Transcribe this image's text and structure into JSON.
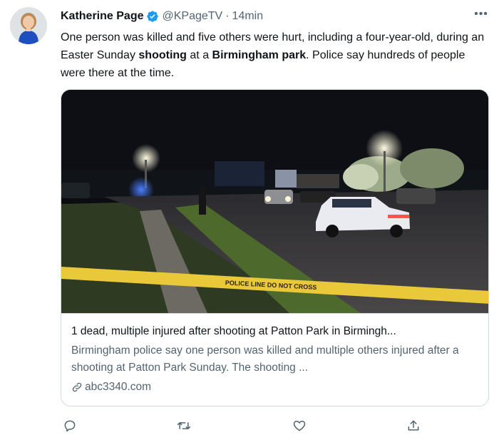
{
  "tweet": {
    "author": {
      "display_name": "Katherine Page",
      "handle": "@KPageTV",
      "verified": true
    },
    "separator": "·",
    "timestamp": "14min",
    "more_label": "•••",
    "text_parts": [
      "One person was killed and five others were hurt, including a four-year-old, during an Easter Sunday ",
      "shooting",
      " at a ",
      "Birmingham park",
      ". Police say hundreds of people were there at the time."
    ]
  },
  "card": {
    "title": "1 dead, multiple injured after shooting at Patton Park in Birmingh...",
    "description": "Birmingham police say one person was killed and multiple others injured after a shooting at Patton Park Sunday. The shooting ...",
    "domain": "abc3340.com",
    "image_tape_text": "POLICE LINE DO NOT CROSS"
  },
  "actions": [
    "reply-icon",
    "retweet-icon",
    "like-icon",
    "share-icon"
  ],
  "colors": {
    "text_primary": "#0f1419",
    "text_secondary": "#536471",
    "verified_blue": "#1d9bf0",
    "border": "#cfd9de",
    "tape_yellow": "#e9c83a"
  }
}
